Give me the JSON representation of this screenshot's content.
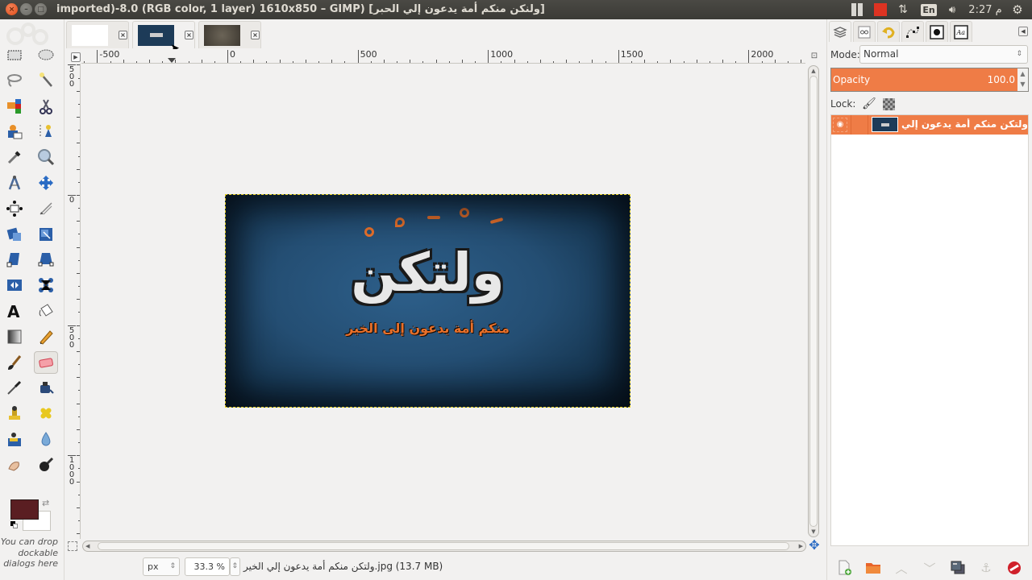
{
  "window": {
    "title": "imported)-8.0 (RGB color, 1 layer) 1610x850 – GIMP) [ولنكن منكم أمة يدعون إلي الحبر]",
    "controls": [
      "close",
      "minimize",
      "maximize"
    ]
  },
  "system_tray": {
    "keyboard_layout": "En",
    "clock": "2:27 م",
    "icons": [
      "pause-icon",
      "record-stop-icon",
      "network-icon",
      "volume-icon",
      "power-icon"
    ]
  },
  "toolbox": {
    "tools": [
      {
        "name": "rect-select",
        "icon": "rect-select-icon"
      },
      {
        "name": "ellipse-select",
        "icon": "ellipse-select-icon"
      },
      {
        "name": "free-select",
        "icon": "lasso-icon"
      },
      {
        "name": "fuzzy-select",
        "icon": "magic-wand-icon"
      },
      {
        "name": "select-by-color",
        "icon": "color-select-icon"
      },
      {
        "name": "scissors-select",
        "icon": "scissors-icon"
      },
      {
        "name": "foreground-select",
        "icon": "foreground-select-icon"
      },
      {
        "name": "paths",
        "icon": "paths-pen-icon"
      },
      {
        "name": "color-picker",
        "icon": "eyedropper-icon"
      },
      {
        "name": "zoom",
        "icon": "magnifier-icon"
      },
      {
        "name": "measure",
        "icon": "compass-icon"
      },
      {
        "name": "move",
        "icon": "move-arrows-icon"
      },
      {
        "name": "align",
        "icon": "align-icon"
      },
      {
        "name": "crop",
        "icon": "crop-knife-icon"
      },
      {
        "name": "rotate",
        "icon": "rotate-icon"
      },
      {
        "name": "scale",
        "icon": "scale-icon"
      },
      {
        "name": "shear",
        "icon": "shear-icon"
      },
      {
        "name": "perspective",
        "icon": "perspective-icon"
      },
      {
        "name": "flip",
        "icon": "flip-icon"
      },
      {
        "name": "cage",
        "icon": "cage-icon"
      },
      {
        "name": "text",
        "icon": "text-a-icon"
      },
      {
        "name": "bucket-fill",
        "icon": "bucket-icon"
      },
      {
        "name": "blend",
        "icon": "gradient-icon"
      },
      {
        "name": "pencil",
        "icon": "pencil-icon"
      },
      {
        "name": "paintbrush",
        "icon": "paintbrush-icon"
      },
      {
        "name": "eraser",
        "icon": "eraser-icon",
        "active": true
      },
      {
        "name": "airbrush",
        "icon": "airbrush-icon"
      },
      {
        "name": "ink",
        "icon": "ink-icon"
      },
      {
        "name": "clone",
        "icon": "clone-stamp-icon"
      },
      {
        "name": "heal",
        "icon": "heal-bandage-icon"
      },
      {
        "name": "perspective-clone",
        "icon": "perspective-clone-icon"
      },
      {
        "name": "blur-sharpen",
        "icon": "water-drop-icon"
      },
      {
        "name": "smudge",
        "icon": "smudge-finger-icon"
      },
      {
        "name": "dodge-burn",
        "icon": "dodge-burn-icon"
      }
    ],
    "foreground_color": "#5a1e22",
    "background_color": "#ffffff",
    "dock_hint": "You can drop dockable dialogs here"
  },
  "image_tabs": [
    {
      "label": "blank-image",
      "active": false
    },
    {
      "label": "ولتكن-image",
      "active": true
    },
    {
      "label": "texture-image",
      "active": false
    }
  ],
  "rulers": {
    "horizontal_labels": [
      "-500",
      "0",
      "500",
      "1000",
      "1500",
      "2000"
    ],
    "vertical_labels": [
      "500",
      "0",
      "500",
      "1000"
    ]
  },
  "image_content": {
    "main_word": "ولتكن",
    "sub_phrase": "منكم أمة يدعون إلى الخير",
    "background_color": "#244e73",
    "accent_color": "#e8702a"
  },
  "statusbar": {
    "unit": "px",
    "zoom": "33.3 %",
    "message": "ولتكن منكم أمة يدعون إلي الخير.jpg (13.7 MB)"
  },
  "dock": {
    "tabs": [
      "layers-icon",
      "channels-icon",
      "undo-history-icon",
      "paths-icon",
      "brush-icon",
      "fonts-icon"
    ],
    "mode_label": "Mode:",
    "mode_value": "Normal",
    "opacity_label": "Opacity",
    "opacity_value": "100.0",
    "lock_label": "Lock:",
    "layers": [
      {
        "name": "ولتكن منكم أمة يدعون إلي الخير.jpg",
        "visible": true
      }
    ],
    "bottom_buttons": [
      "new-layer-icon",
      "new-layer-group-icon",
      "raise-layer-icon",
      "lower-layer-icon",
      "duplicate-layer-icon",
      "anchor-layer-icon",
      "delete-layer-icon"
    ]
  }
}
